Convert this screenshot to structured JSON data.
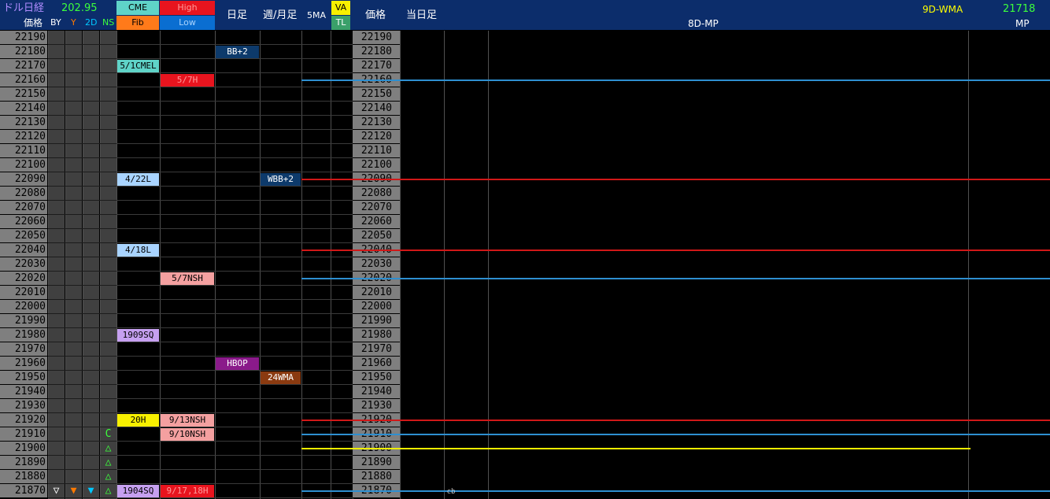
{
  "header": {
    "title": "ドル日経",
    "value": "202.95",
    "price_label": "価格",
    "by": "BY",
    "y": "Y",
    "d2": "2D",
    "ns": "NS",
    "cme": "CME",
    "fib": "Fib",
    "high": "High",
    "low": "Low",
    "daily": "日足",
    "weekly": "週/月足",
    "ma5": "5MA",
    "va": "VA",
    "tl": "TL",
    "price_label2": "価格",
    "today": "当日足",
    "mp8d": "8D-MP",
    "wma9d": "9D-WMA",
    "mp_value": "21718",
    "mp": "MP"
  },
  "prices": [
    22190,
    22180,
    22170,
    22160,
    22150,
    22140,
    22130,
    22120,
    22110,
    22100,
    22090,
    22080,
    22070,
    22060,
    22050,
    22040,
    22030,
    22020,
    22010,
    22000,
    21990,
    21980,
    21970,
    21960,
    21950,
    21940,
    21930,
    21920,
    21910,
    21900,
    21890,
    21880,
    21870
  ],
  "tags": {
    "cme_5_1": {
      "text": "5/1CMEL",
      "price": 22170,
      "col": "cme",
      "bg": "#5fd3c8",
      "fg": "#000"
    },
    "high_5_7": {
      "text": "5/7H",
      "price": 22160,
      "col": "high",
      "bg": "#e8141e",
      "fg": "#ff9a9a"
    },
    "daily_bb": {
      "text": "BB+2",
      "price": 22180,
      "col": "daily",
      "bg": "#0d3a6b",
      "fg": "#fff"
    },
    "cme_4_22": {
      "text": "4/22L",
      "price": 22090,
      "col": "cme",
      "bg": "#a9d4ff",
      "fg": "#000"
    },
    "weekly_wbb": {
      "text": "WBB+2",
      "price": 22090,
      "col": "weekly",
      "bg": "#0d3a6b",
      "fg": "#fff"
    },
    "cme_4_18": {
      "text": "4/18L",
      "price": 22040,
      "col": "cme",
      "bg": "#a9d4ff",
      "fg": "#000"
    },
    "high_5_7nsh": {
      "text": "5/7NSH",
      "price": 22020,
      "col": "high",
      "bg": "#f4a0a0",
      "fg": "#000"
    },
    "cme_1909": {
      "text": "1909SQ",
      "price": 21980,
      "col": "cme",
      "bg": "#c6a0f0",
      "fg": "#000"
    },
    "daily_hbop": {
      "text": "HBOP",
      "price": 21960,
      "col": "daily",
      "bg": "#8a1a8a",
      "fg": "#fff"
    },
    "weekly_24": {
      "text": "24WMA",
      "price": 21950,
      "col": "weekly",
      "bg": "#8a3a10",
      "fg": "#fff"
    },
    "cme_20h": {
      "text": "20H",
      "price": 21920,
      "col": "cme",
      "bg": "#f8f000",
      "fg": "#000"
    },
    "high_9_13": {
      "text": "9/13NSH",
      "price": 21920,
      "col": "high",
      "bg": "#f4a0a0",
      "fg": "#000"
    },
    "high_9_10": {
      "text": "9/10NSH",
      "price": 21910,
      "col": "high",
      "bg": "#f4a0a0",
      "fg": "#000"
    },
    "cme_1904": {
      "text": "1904SQ",
      "price": 21870,
      "col": "cme",
      "bg": "#c6a0f0",
      "fg": "#000"
    },
    "high_9_17": {
      "text": "9/17,18H",
      "price": 21870,
      "col": "high",
      "bg": "#e8141e",
      "fg": "#ff9a9a"
    }
  },
  "ns_markers": [
    {
      "symbol": "C",
      "price": 21910
    },
    {
      "symbol": "△",
      "price": 21900
    },
    {
      "symbol": "△",
      "price": 21890
    },
    {
      "symbol": "△",
      "price": 21880
    },
    {
      "symbol": "△",
      "price": 21870
    }
  ],
  "bottom_markers": {
    "by": "▽",
    "y": "▼",
    "d2": "▼",
    "by_color": "#ffffff",
    "y_color": "#ff7a00",
    "d2_color": "#00c8ff"
  },
  "levels": [
    {
      "price": 22160,
      "color": "#2e8fd0",
      "extent": "full"
    },
    {
      "price": 22090,
      "color": "#d01818",
      "extent": "full"
    },
    {
      "price": 22040,
      "color": "#d01818",
      "extent": "full"
    },
    {
      "price": 22020,
      "color": "#2e8fd0",
      "extent": "full"
    },
    {
      "price": 21920,
      "color": "#d01818",
      "extent": "full"
    },
    {
      "price": 21910,
      "color": "#2e8fd0",
      "extent": "full"
    },
    {
      "price": 21900,
      "color": "#f0f000",
      "extent": "partial"
    },
    {
      "price": 21870,
      "color": "#2e8fd0",
      "extent": "full"
    }
  ],
  "today_marker": "cb",
  "colors": {
    "header_bg": "#0c2d6b",
    "grid": "#3a3a3a",
    "accent_green": "#3cff3c",
    "accent_yellow": "#ffff00"
  }
}
